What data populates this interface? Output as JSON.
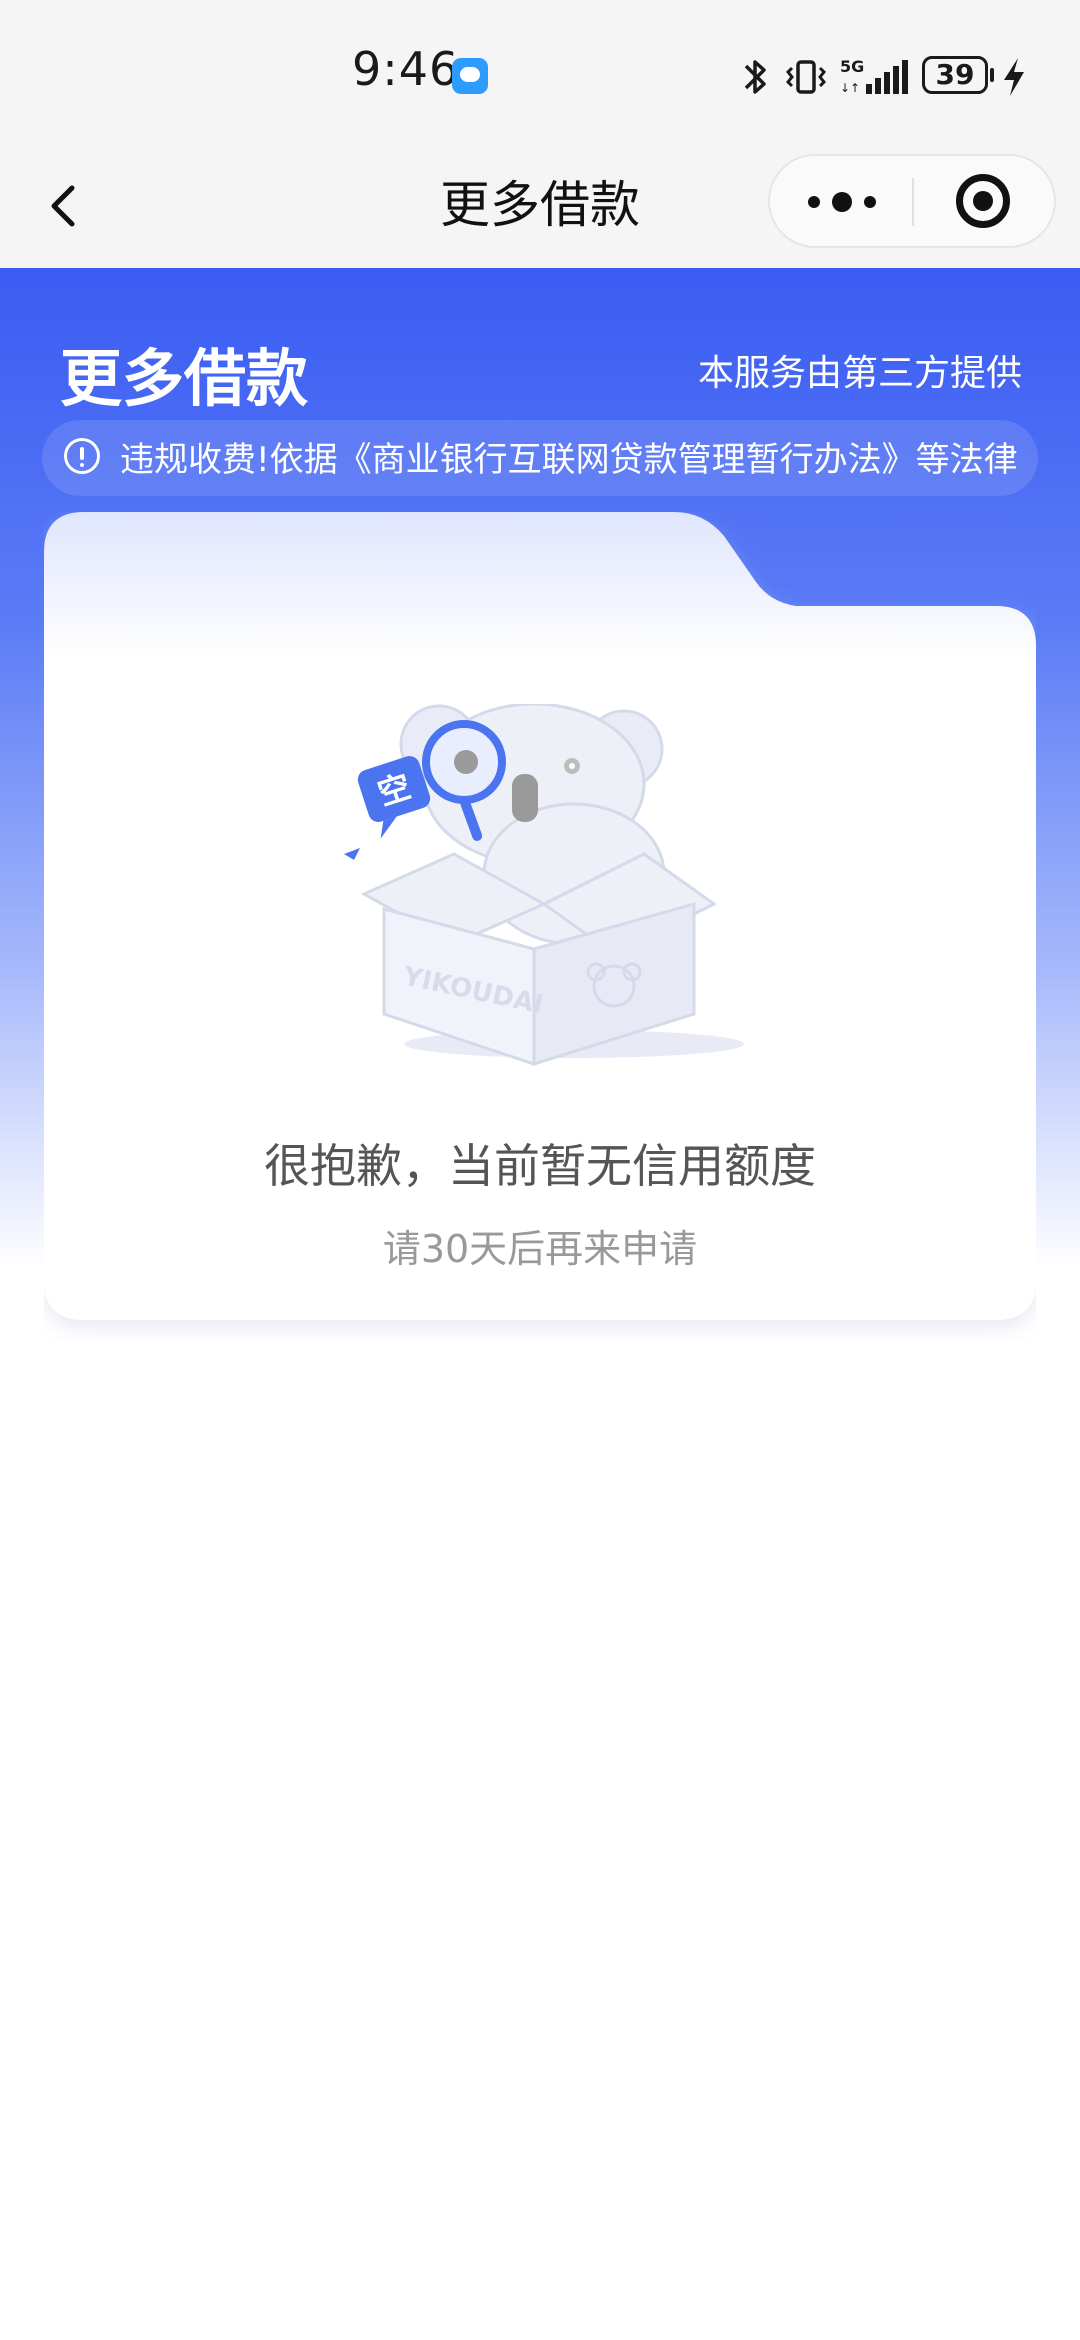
{
  "status_bar": {
    "time": "9:46",
    "battery": "39",
    "icons": [
      "message-icon",
      "bluetooth-icon",
      "vibrate-icon",
      "5g-signal-icon",
      "battery-icon",
      "charging-icon"
    ]
  },
  "nav": {
    "title": "更多借款",
    "back_icon": "chevron-left-icon",
    "more_icon": "more-dots-icon",
    "close_icon": "target-close-icon"
  },
  "hero": {
    "title": "更多借款",
    "provider_note": "本服务由第三方提供",
    "notice": "违规收费!依据《商业银行互联网贷款管理暂行办法》等法律"
  },
  "empty_state": {
    "badge": "空",
    "box_brand": "YIKOUDAI",
    "title": "很抱歉，当前暂无信用额度",
    "subtitle": "请30天后再来申请"
  },
  "colors": {
    "brand_blue": "#3a5cf2",
    "text_primary": "#555555",
    "text_secondary": "#999999"
  }
}
